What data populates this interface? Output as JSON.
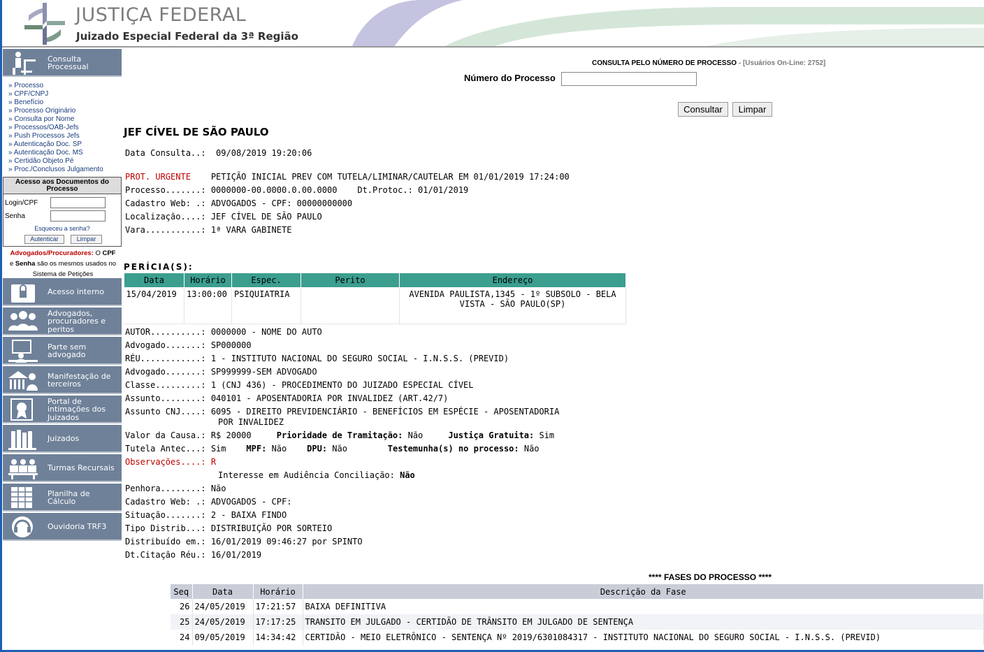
{
  "header": {
    "title": "JUSTIÇA FEDERAL",
    "subtitle": "Juizado Especial Federal da 3ª Região"
  },
  "sidebar": {
    "consulta_tile": "Consulta Processual",
    "links": [
      "» Processo",
      "» CPF/CNPJ",
      "» Benefício",
      "» Processo Originário",
      "» Consulta por Nome",
      "» Processos/OAB-Jefs",
      "» Push Processos Jefs",
      "» Autenticação Doc. SP",
      "» Autenticação Doc. MS",
      "» Certidão Objeto Pé",
      "» Proc./Conclusos Julgamento"
    ],
    "login": {
      "title": "Acesso aos Documentos do Processo",
      "login_label": "Login/CPF",
      "senha_label": "Senha",
      "forgot": "Esqueceu a senha?",
      "auth_button": "Autenticar",
      "clear_button": "Limpar",
      "note_red": "Advogados/Procuradores:",
      "note_o": " O ",
      "note_cpf": "CPF",
      "note_e": "e ",
      "note_senha": "Senha",
      "note_rest": " são os mesmos usados no Sistema de Petições"
    },
    "tiles": [
      {
        "label": "Acesso interno",
        "icon": "lock-folder-icon"
      },
      {
        "label": "Advogados, procuradores e peritos",
        "icon": "people-group-icon"
      },
      {
        "label": "Parte sem advogado",
        "icon": "person-computer-icon"
      },
      {
        "label": "Manifestação de terceiros",
        "icon": "building-person-icon"
      },
      {
        "label": "Portal de intimações dos Juizados",
        "icon": "portal-certificate-icon"
      },
      {
        "label": "Juizados",
        "icon": "books-icon"
      },
      {
        "label": "Turmas Recursais",
        "icon": "meeting-icon"
      },
      {
        "label": "Planilha de Cálculo",
        "icon": "spreadsheet-icon"
      },
      {
        "label": "Ouvidoria TRF3",
        "icon": "headset-icon"
      }
    ]
  },
  "search": {
    "title": "CONSULTA PELO NÚMERO DE PROCESSO",
    "online": " - [Usuários On-Line: 2752]",
    "label": "Número do Processo",
    "value": "",
    "consultar": "Consultar",
    "limpar": "Limpar"
  },
  "court_title": "JEF CÍVEL DE SÃO PAULO",
  "info": {
    "data_consulta_label": "Data Consulta..:",
    "data_consulta": "09/08/2019 19:20:06",
    "prot_label": "PROT. URGENTE",
    "prot_value": "PETIÇÃO INICIAL PREV COM TUTELA/LIMINAR/CAUTELAR EM 01/01/2019 17:24:00",
    "processo_label": "Processo.......:",
    "processo_value": "0000000-00.0000.0.00.0000    Dt.Protoc.: 01/01/2019",
    "cadastro_label": "Cadastro Web: .:",
    "cadastro_value": "ADVOGADOS - CPF: 00000000000",
    "localizacao_label": "Localização....:",
    "localizacao_value": "JEF CÍVEL DE SÃO PAULO",
    "vara_label": "Vara...........:",
    "vara_value": "1ª VARA GABINETE"
  },
  "pericia": {
    "title": "PERÍCIA(S):",
    "headers": [
      "Data",
      "Horário",
      "Espec.",
      "Perito",
      "Endereço"
    ],
    "rows": [
      [
        "15/04/2019",
        "13:00:00",
        "PSIQUIATRIA",
        "",
        "AVENIDA PAULISTA,1345 - 1º SUBSOLO - BELA VISTA - SÃO PAULO(SP)"
      ]
    ]
  },
  "details": [
    {
      "label": "AUTOR..........:",
      "value": "0000000 - NOME DO AUTO"
    },
    {
      "label": "Advogado.......:",
      "value": "SP000000"
    },
    {
      "label": "RÉU............:",
      "value": "1 - INSTITUTO NACIONAL DO SEGURO SOCIAL - I.N.S.S. (PREVID)"
    },
    {
      "label": "Advogado.......:",
      "value": "SP999999-SEM ADVOGADO"
    },
    {
      "label": "Classe.........:",
      "value": "1 (CNJ 436) - PROCEDIMENTO DO JUIZADO ESPECIAL CÍVEL"
    },
    {
      "label": "Assunto........:",
      "value": "040101 - APOSENTADORIA POR INVALIDEZ (ART.42/7)"
    },
    {
      "label": "Assunto CNJ....:",
      "value": "6095 - DIREITO PREVIDENCIÁRIO - BENEFÍCIOS EM ESPÉCIE - APOSENTADORIA"
    },
    {
      "label": "",
      "value": "POR INVALIDEZ"
    }
  ],
  "valor": {
    "label": "Valor da Causa.:",
    "value": "R$ 20000",
    "prioridade_label": "Prioridade de Tramitação:",
    "prioridade_value": "Não",
    "gratuita_label": "Justiça Gratuita:",
    "gratuita_value": "Sim"
  },
  "tutela": {
    "label": "Tutela Antec...:",
    "value": "Sim",
    "mpf_label": "MPF:",
    "mpf_value": "Não",
    "dpu_label": "DPU:",
    "dpu_value": "Não",
    "test_label": "Testemunha(s) no processo:",
    "test_value": "Não"
  },
  "observacoes": {
    "label": "Observações....:",
    "value": "R"
  },
  "interesse": {
    "label": "Interesse em Audiência Conciliação:",
    "value": "Não"
  },
  "details2": [
    {
      "label": "Penhora........:",
      "value": "Não"
    },
    {
      "label": "Cadastro Web: .:",
      "value": "ADVOGADOS - CPF:"
    },
    {
      "label": "Situação.......:",
      "value": "2 - BAIXA FINDO"
    },
    {
      "label": "Tipo Distrib...:",
      "value": "DISTRIBUIÇÃO POR SORTEIO"
    },
    {
      "label": "Distribuído em.:",
      "value": "16/01/2019 09:46:27 por SPINTO"
    },
    {
      "label": "Dt.Citação Réu.:",
      "value": "16/01/2019"
    }
  ],
  "fases": {
    "title": "**** FASES DO PROCESSO ****",
    "headers": [
      "Seq",
      "Data",
      "Horário",
      "Descrição da Fase"
    ],
    "rows": [
      [
        "26",
        "24/05/2019",
        "17:21:57",
        "BAIXA DEFINITIVA"
      ],
      [
        "25",
        "24/05/2019",
        "17:17:25",
        "TRANSITO EM JULGADO - CERTIDÃO DE TRÂNSITO EM JULGADO DE SENTENÇA"
      ],
      [
        "24",
        "09/05/2019",
        "14:34:42",
        "CERTIDÃO - MEIO ELETRÔNICO - SENTENÇA Nº 2019/6301084317 - INSTITUTO NACIONAL DO SEGURO SOCIAL - I.N.S.S. (PREVID)"
      ]
    ]
  },
  "colors": {
    "frame": "#1e5fb3",
    "tile": "#6f8199",
    "pericia_header": "#3c9e8f",
    "fases_header": "#c9cdd8",
    "red": "#c00000"
  }
}
